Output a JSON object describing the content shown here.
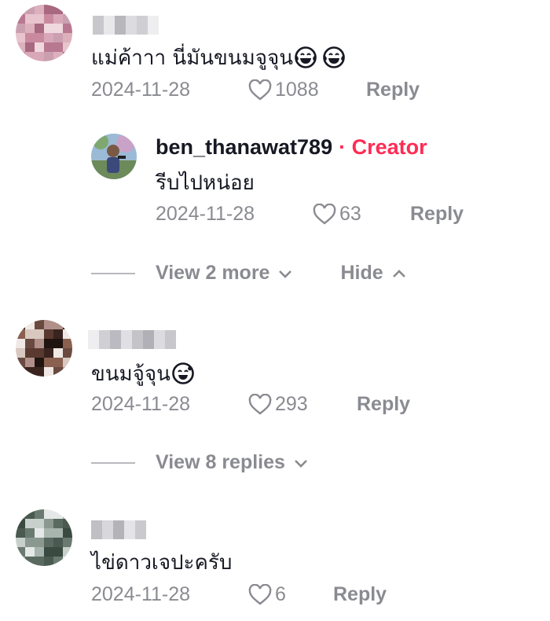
{
  "comments": [
    {
      "text": "แม่ค้าาา นี่มันขนมจูจุน",
      "emoji": [
        "grinning-tears-emoji",
        "grinning-tears-emoji"
      ],
      "date": "2024-11-28",
      "likes": "1088",
      "reply_label": "Reply"
    },
    {
      "text": "ขนมจู้จุน",
      "emoji": [
        "sweat-smile-emoji"
      ],
      "date": "2024-11-28",
      "likes": "293",
      "reply_label": "Reply"
    },
    {
      "text": "ไข่ดาวเจปะครับ",
      "date": "2024-11-28",
      "likes": "6",
      "reply_label": "Reply"
    }
  ],
  "creator_reply": {
    "username": "ben_thanawat789",
    "badge": "· Creator",
    "text": "รีบไปหน่อย",
    "date": "2024-11-28",
    "likes": "63",
    "reply_label": "Reply"
  },
  "thread_controls": {
    "view_more_label": "View 2 more",
    "hide_label": "Hide",
    "view_replies_label": "View 8 replies"
  },
  "colors": {
    "creator_accent": "#fe2c55",
    "meta_gray": "#8a8b91",
    "text": "#161823"
  }
}
